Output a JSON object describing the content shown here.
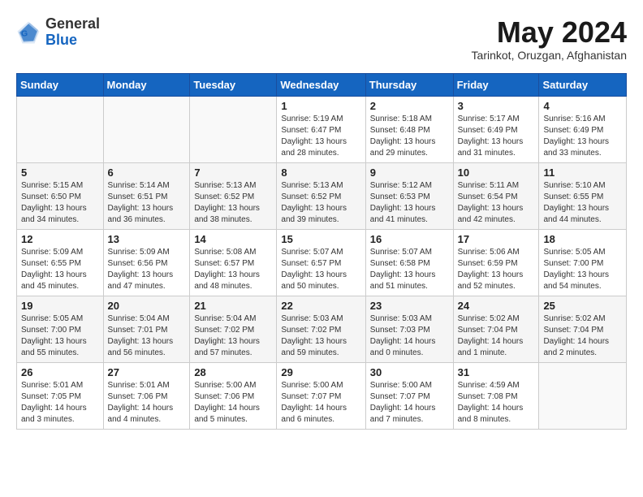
{
  "logo": {
    "general": "General",
    "blue": "Blue"
  },
  "header": {
    "month": "May 2024",
    "location": "Tarinkot, Oruzgan, Afghanistan"
  },
  "weekdays": [
    "Sunday",
    "Monday",
    "Tuesday",
    "Wednesday",
    "Thursday",
    "Friday",
    "Saturday"
  ],
  "weeks": [
    [
      {
        "day": "",
        "sunrise": "",
        "sunset": "",
        "daylight": ""
      },
      {
        "day": "",
        "sunrise": "",
        "sunset": "",
        "daylight": ""
      },
      {
        "day": "",
        "sunrise": "",
        "sunset": "",
        "daylight": ""
      },
      {
        "day": "1",
        "sunrise": "Sunrise: 5:19 AM",
        "sunset": "Sunset: 6:47 PM",
        "daylight": "Daylight: 13 hours and 28 minutes."
      },
      {
        "day": "2",
        "sunrise": "Sunrise: 5:18 AM",
        "sunset": "Sunset: 6:48 PM",
        "daylight": "Daylight: 13 hours and 29 minutes."
      },
      {
        "day": "3",
        "sunrise": "Sunrise: 5:17 AM",
        "sunset": "Sunset: 6:49 PM",
        "daylight": "Daylight: 13 hours and 31 minutes."
      },
      {
        "day": "4",
        "sunrise": "Sunrise: 5:16 AM",
        "sunset": "Sunset: 6:49 PM",
        "daylight": "Daylight: 13 hours and 33 minutes."
      }
    ],
    [
      {
        "day": "5",
        "sunrise": "Sunrise: 5:15 AM",
        "sunset": "Sunset: 6:50 PM",
        "daylight": "Daylight: 13 hours and 34 minutes."
      },
      {
        "day": "6",
        "sunrise": "Sunrise: 5:14 AM",
        "sunset": "Sunset: 6:51 PM",
        "daylight": "Daylight: 13 hours and 36 minutes."
      },
      {
        "day": "7",
        "sunrise": "Sunrise: 5:13 AM",
        "sunset": "Sunset: 6:52 PM",
        "daylight": "Daylight: 13 hours and 38 minutes."
      },
      {
        "day": "8",
        "sunrise": "Sunrise: 5:13 AM",
        "sunset": "Sunset: 6:52 PM",
        "daylight": "Daylight: 13 hours and 39 minutes."
      },
      {
        "day": "9",
        "sunrise": "Sunrise: 5:12 AM",
        "sunset": "Sunset: 6:53 PM",
        "daylight": "Daylight: 13 hours and 41 minutes."
      },
      {
        "day": "10",
        "sunrise": "Sunrise: 5:11 AM",
        "sunset": "Sunset: 6:54 PM",
        "daylight": "Daylight: 13 hours and 42 minutes."
      },
      {
        "day": "11",
        "sunrise": "Sunrise: 5:10 AM",
        "sunset": "Sunset: 6:55 PM",
        "daylight": "Daylight: 13 hours and 44 minutes."
      }
    ],
    [
      {
        "day": "12",
        "sunrise": "Sunrise: 5:09 AM",
        "sunset": "Sunset: 6:55 PM",
        "daylight": "Daylight: 13 hours and 45 minutes."
      },
      {
        "day": "13",
        "sunrise": "Sunrise: 5:09 AM",
        "sunset": "Sunset: 6:56 PM",
        "daylight": "Daylight: 13 hours and 47 minutes."
      },
      {
        "day": "14",
        "sunrise": "Sunrise: 5:08 AM",
        "sunset": "Sunset: 6:57 PM",
        "daylight": "Daylight: 13 hours and 48 minutes."
      },
      {
        "day": "15",
        "sunrise": "Sunrise: 5:07 AM",
        "sunset": "Sunset: 6:57 PM",
        "daylight": "Daylight: 13 hours and 50 minutes."
      },
      {
        "day": "16",
        "sunrise": "Sunrise: 5:07 AM",
        "sunset": "Sunset: 6:58 PM",
        "daylight": "Daylight: 13 hours and 51 minutes."
      },
      {
        "day": "17",
        "sunrise": "Sunrise: 5:06 AM",
        "sunset": "Sunset: 6:59 PM",
        "daylight": "Daylight: 13 hours and 52 minutes."
      },
      {
        "day": "18",
        "sunrise": "Sunrise: 5:05 AM",
        "sunset": "Sunset: 7:00 PM",
        "daylight": "Daylight: 13 hours and 54 minutes."
      }
    ],
    [
      {
        "day": "19",
        "sunrise": "Sunrise: 5:05 AM",
        "sunset": "Sunset: 7:00 PM",
        "daylight": "Daylight: 13 hours and 55 minutes."
      },
      {
        "day": "20",
        "sunrise": "Sunrise: 5:04 AM",
        "sunset": "Sunset: 7:01 PM",
        "daylight": "Daylight: 13 hours and 56 minutes."
      },
      {
        "day": "21",
        "sunrise": "Sunrise: 5:04 AM",
        "sunset": "Sunset: 7:02 PM",
        "daylight": "Daylight: 13 hours and 57 minutes."
      },
      {
        "day": "22",
        "sunrise": "Sunrise: 5:03 AM",
        "sunset": "Sunset: 7:02 PM",
        "daylight": "Daylight: 13 hours and 59 minutes."
      },
      {
        "day": "23",
        "sunrise": "Sunrise: 5:03 AM",
        "sunset": "Sunset: 7:03 PM",
        "daylight": "Daylight: 14 hours and 0 minutes."
      },
      {
        "day": "24",
        "sunrise": "Sunrise: 5:02 AM",
        "sunset": "Sunset: 7:04 PM",
        "daylight": "Daylight: 14 hours and 1 minute."
      },
      {
        "day": "25",
        "sunrise": "Sunrise: 5:02 AM",
        "sunset": "Sunset: 7:04 PM",
        "daylight": "Daylight: 14 hours and 2 minutes."
      }
    ],
    [
      {
        "day": "26",
        "sunrise": "Sunrise: 5:01 AM",
        "sunset": "Sunset: 7:05 PM",
        "daylight": "Daylight: 14 hours and 3 minutes."
      },
      {
        "day": "27",
        "sunrise": "Sunrise: 5:01 AM",
        "sunset": "Sunset: 7:06 PM",
        "daylight": "Daylight: 14 hours and 4 minutes."
      },
      {
        "day": "28",
        "sunrise": "Sunrise: 5:00 AM",
        "sunset": "Sunset: 7:06 PM",
        "daylight": "Daylight: 14 hours and 5 minutes."
      },
      {
        "day": "29",
        "sunrise": "Sunrise: 5:00 AM",
        "sunset": "Sunset: 7:07 PM",
        "daylight": "Daylight: 14 hours and 6 minutes."
      },
      {
        "day": "30",
        "sunrise": "Sunrise: 5:00 AM",
        "sunset": "Sunset: 7:07 PM",
        "daylight": "Daylight: 14 hours and 7 minutes."
      },
      {
        "day": "31",
        "sunrise": "Sunrise: 4:59 AM",
        "sunset": "Sunset: 7:08 PM",
        "daylight": "Daylight: 14 hours and 8 minutes."
      },
      {
        "day": "",
        "sunrise": "",
        "sunset": "",
        "daylight": ""
      }
    ]
  ]
}
